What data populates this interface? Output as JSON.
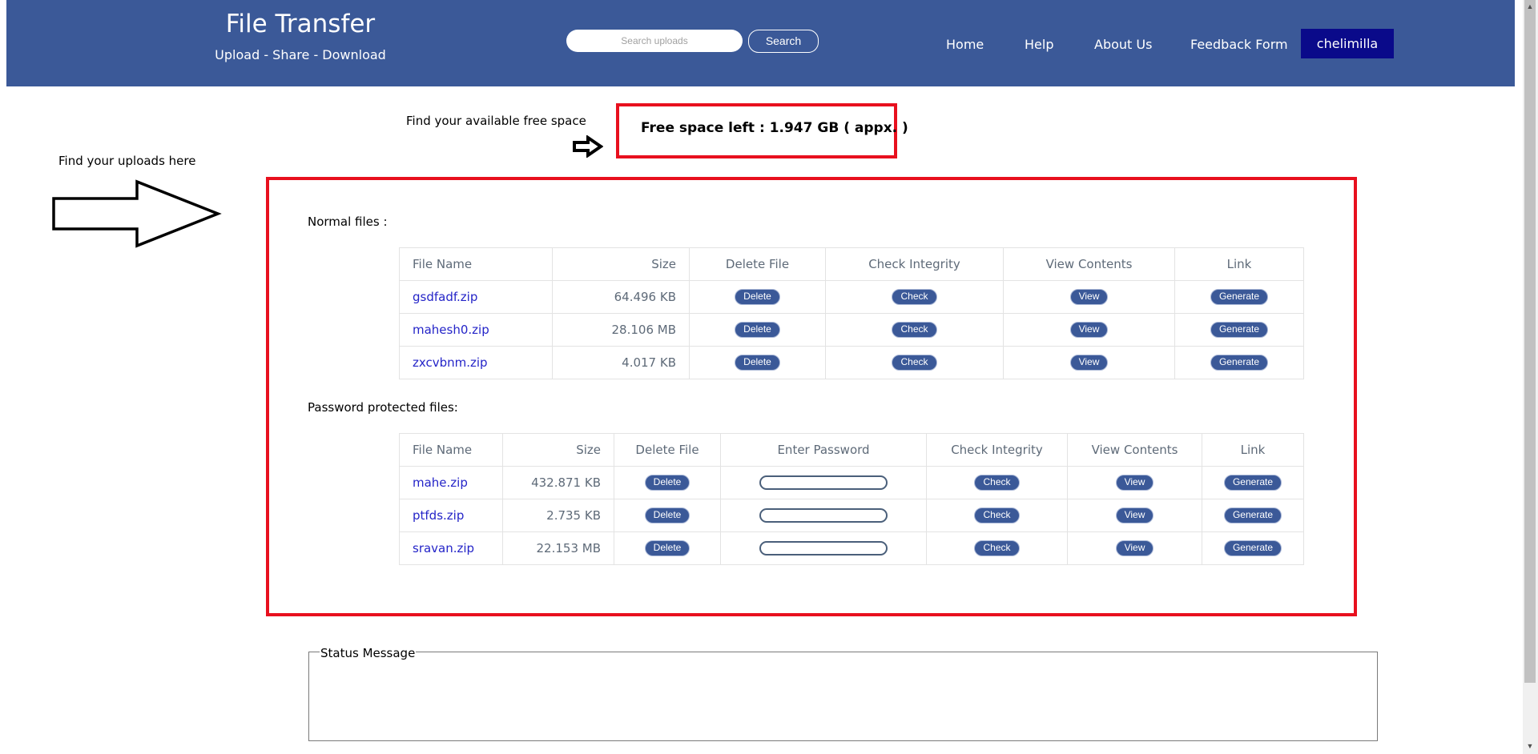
{
  "header": {
    "brand_title": "File Transfer",
    "brand_subtitle": "Upload - Share - Download",
    "search_placeholder": "Search uploads",
    "search_button": "Search",
    "nav": [
      "Home",
      "Help",
      "About Us",
      "Feedback Form"
    ],
    "user": "chelimilla",
    "background_color": "#3b5998",
    "user_button_color": "#0a0a8a"
  },
  "annotations": {
    "free_space_hint": "Find your available free space",
    "uploads_hint": "Find your uploads here",
    "highlight_color": "#e8101e"
  },
  "free_space": {
    "text": "Free space left : 1.947 GB ( appx. )"
  },
  "normal_files": {
    "label": "Normal files :",
    "columns": [
      "File Name",
      "Size",
      "Delete File",
      "Check Integrity",
      "View Contents",
      "Link"
    ],
    "rows": [
      {
        "name": "gsdfadf.zip",
        "size": "64.496 KB",
        "delete": "Delete",
        "check": "Check",
        "view": "View",
        "link": "Generate"
      },
      {
        "name": "mahesh0.zip",
        "size": "28.106 MB",
        "delete": "Delete",
        "check": "Check",
        "view": "View",
        "link": "Generate"
      },
      {
        "name": "zxcvbnm.zip",
        "size": "4.017 KB",
        "delete": "Delete",
        "check": "Check",
        "view": "View",
        "link": "Generate"
      }
    ]
  },
  "protected_files": {
    "label": "Password protected files:",
    "columns": [
      "File Name",
      "Size",
      "Delete File",
      "Enter Password",
      "Check Integrity",
      "View Contents",
      "Link"
    ],
    "rows": [
      {
        "name": "mahe.zip",
        "size": "432.871 KB",
        "delete": "Delete",
        "password": "",
        "check": "Check",
        "view": "View",
        "link": "Generate"
      },
      {
        "name": "ptfds.zip",
        "size": "2.735 KB",
        "delete": "Delete",
        "password": "",
        "check": "Check",
        "view": "View",
        "link": "Generate"
      },
      {
        "name": "sravan.zip",
        "size": "22.153 MB",
        "delete": "Delete",
        "password": "",
        "check": "Check",
        "view": "View",
        "link": "Generate"
      }
    ]
  },
  "status": {
    "legend": "Status Message",
    "message": ""
  }
}
